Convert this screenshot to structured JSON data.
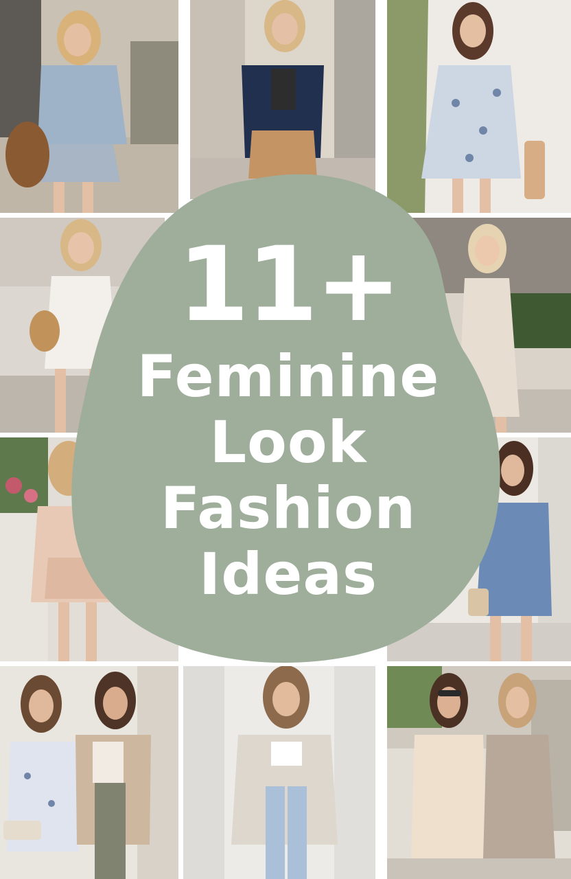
{
  "pin": {
    "title_number": "11+",
    "title_lines": [
      "Feminine",
      "Look",
      "Fashion",
      "Ideas"
    ]
  },
  "colors": {
    "blob": "#9eae9b",
    "title_text": "#ffffff",
    "gutter": "#ffffff"
  },
  "photos": [
    {
      "subject": "woman in light denim shirt, layered skirt, woven tote"
    },
    {
      "subject": "woman in navy blazer and tan wide-leg trousers"
    },
    {
      "subject": "woman in floral mini dress with tan shoulder bag"
    },
    {
      "subject": "woman in white v-neck dress with straw bag"
    },
    {
      "subject": "woman in light linen sleeveless midi dress"
    },
    {
      "subject": "woman in blush knit cardigan and dress near flowers"
    },
    {
      "subject": "woman in blue belted midi dress with beige bag"
    },
    {
      "subject": "two women in floral dress and neutral cardigan outfits"
    },
    {
      "subject": "woman in cream cardigan, crop top and light jeans"
    },
    {
      "subject": "two women in cream and taupe belted summer dresses"
    }
  ]
}
